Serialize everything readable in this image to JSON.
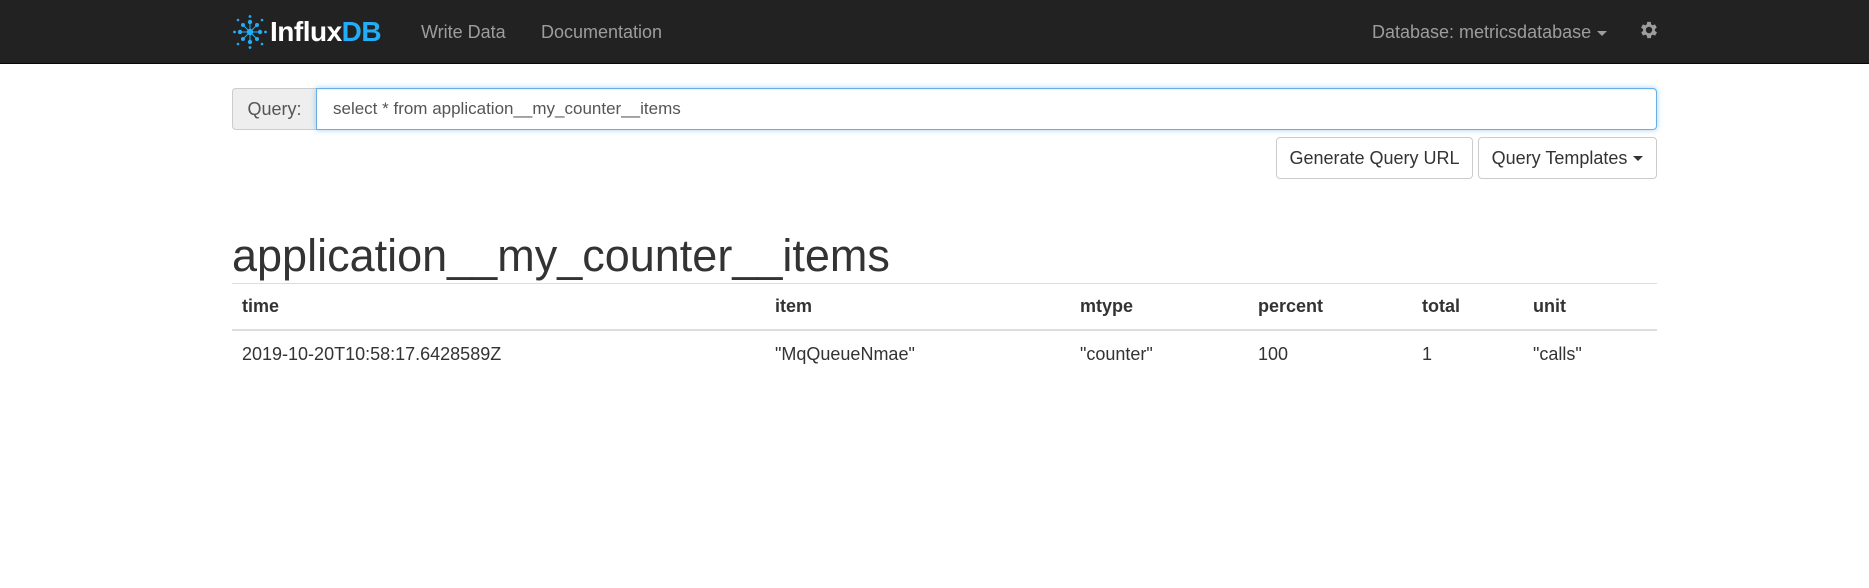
{
  "navbar": {
    "brand_part1": "Influx",
    "brand_part2": "DB",
    "write_data_label": "Write Data",
    "documentation_label": "Documentation",
    "database_label": "Database: metricsdatabase",
    "settings_icon": "gear-icon",
    "logo_icon": "influxdb-logo-icon",
    "colors": {
      "background": "#222222",
      "link": "#9d9d9d",
      "brand_accent": "#22adf6"
    }
  },
  "query": {
    "label": "Query:",
    "value": "select * from application__my_counter__items"
  },
  "buttons": {
    "generate_query_url": "Generate Query URL",
    "query_templates": "Query Templates"
  },
  "results": {
    "series_name": "application__my_counter__items",
    "columns": [
      "time",
      "item",
      "mtype",
      "percent",
      "total",
      "unit"
    ],
    "rows": [
      [
        "2019-10-20T10:58:17.6428589Z",
        "\"MqQueueNmae\"",
        "\"counter\"",
        "100",
        "1",
        "\"calls\""
      ]
    ]
  }
}
